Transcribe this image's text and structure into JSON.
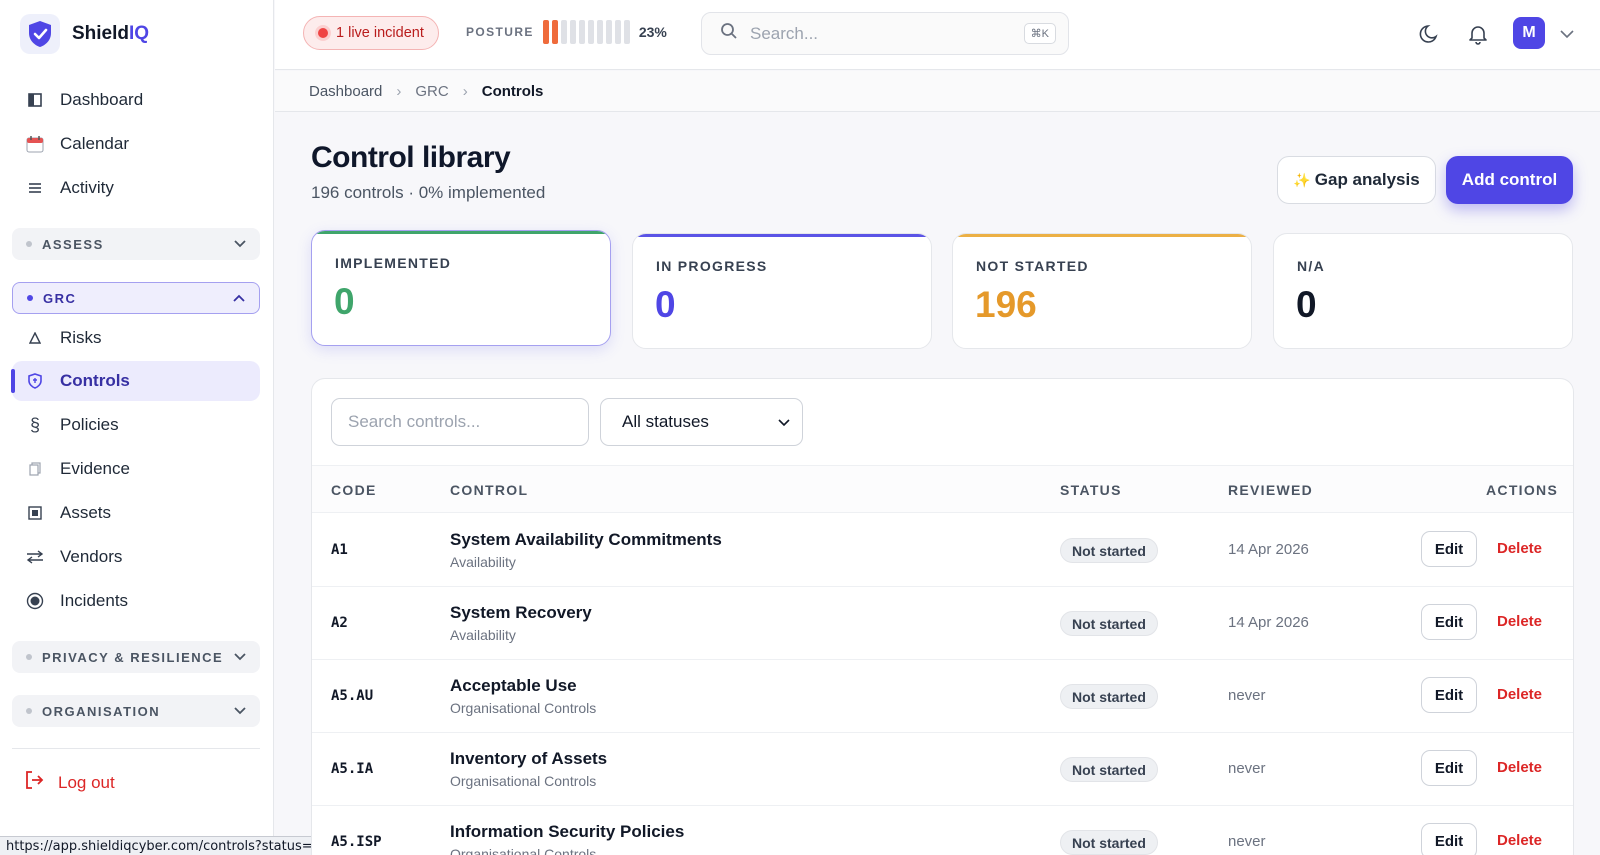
{
  "app": {
    "brand_prefix": "Shield",
    "brand_suffix": "IQ"
  },
  "sidebar": {
    "top_items": [
      {
        "label": "Dashboard",
        "icon": "dashboard-icon"
      },
      {
        "label": "Calendar",
        "icon": "calendar-icon"
      },
      {
        "label": "Activity",
        "icon": "activity-icon"
      }
    ],
    "sections": {
      "assess": "ASSESS",
      "grc": "GRC",
      "privacy": "PRIVACY & RESILIENCE",
      "organisation": "ORGANISATION"
    },
    "grc_items": [
      {
        "label": "Risks",
        "icon": "warning-icon"
      },
      {
        "label": "Controls",
        "icon": "shield-icon",
        "active": true
      },
      {
        "label": "Policies",
        "icon": "section-icon"
      },
      {
        "label": "Evidence",
        "icon": "document-icon"
      },
      {
        "label": "Assets",
        "icon": "asset-icon"
      },
      {
        "label": "Vendors",
        "icon": "swap-icon"
      },
      {
        "label": "Incidents",
        "icon": "target-icon"
      }
    ],
    "logout": "Log out"
  },
  "topbar": {
    "incident": "1 live incident",
    "posture_label": "POSTURE",
    "posture_value": 0.23,
    "posture_pct": "23%",
    "search_placeholder": "Search...",
    "search_shortcut": "⌘K",
    "avatar_initial": "M"
  },
  "breadcrumb": {
    "items": [
      "Dashboard",
      "GRC",
      "Controls"
    ]
  },
  "page": {
    "title": "Control library",
    "subtitle": "196 controls · 0% implemented",
    "gap_button": "Gap analysis",
    "gap_icon": "✨",
    "add_button": "Add control"
  },
  "stats": [
    {
      "label": "IMPLEMENTED",
      "value": "0",
      "color": "#3fa56b",
      "accent": "#3fa56b",
      "selected": true
    },
    {
      "label": "IN PROGRESS",
      "value": "0",
      "color": "#4f46e5",
      "accent": "#5b54e6"
    },
    {
      "label": "NOT STARTED",
      "value": "196",
      "color": "#e5992a",
      "accent": "#ecb045"
    },
    {
      "label": "N/A",
      "value": "0",
      "color": "#111827",
      "accent": "#ffffff"
    }
  ],
  "filters": {
    "search_placeholder": "Search controls...",
    "status_selected": "All statuses"
  },
  "table": {
    "headers": {
      "code": "CODE",
      "control": "CONTROL",
      "status": "STATUS",
      "reviewed": "REVIEWED",
      "actions": "ACTIONS"
    },
    "edit_label": "Edit",
    "delete_label": "Delete",
    "rows": [
      {
        "code": "A1",
        "name": "System Availability Commitments",
        "category": "Availability",
        "status": "Not started",
        "reviewed": "14 Apr 2026"
      },
      {
        "code": "A2",
        "name": "System Recovery",
        "category": "Availability",
        "status": "Not started",
        "reviewed": "14 Apr 2026"
      },
      {
        "code": "A5.AU",
        "name": "Acceptable Use",
        "category": "Organisational Controls",
        "status": "Not started",
        "reviewed": "never"
      },
      {
        "code": "A5.IA",
        "name": "Inventory of Assets",
        "category": "Organisational Controls",
        "status": "Not started",
        "reviewed": "never"
      },
      {
        "code": "A5.ISP",
        "name": "Information Security Policies",
        "category": "Organisational Controls",
        "status": "Not started",
        "reviewed": "never"
      }
    ]
  },
  "status_bar_url": "https://app.shieldiqcyber.com/controls?status=implemented",
  "colors": {
    "accent": "#4f46e5",
    "danger": "#dc2626"
  }
}
